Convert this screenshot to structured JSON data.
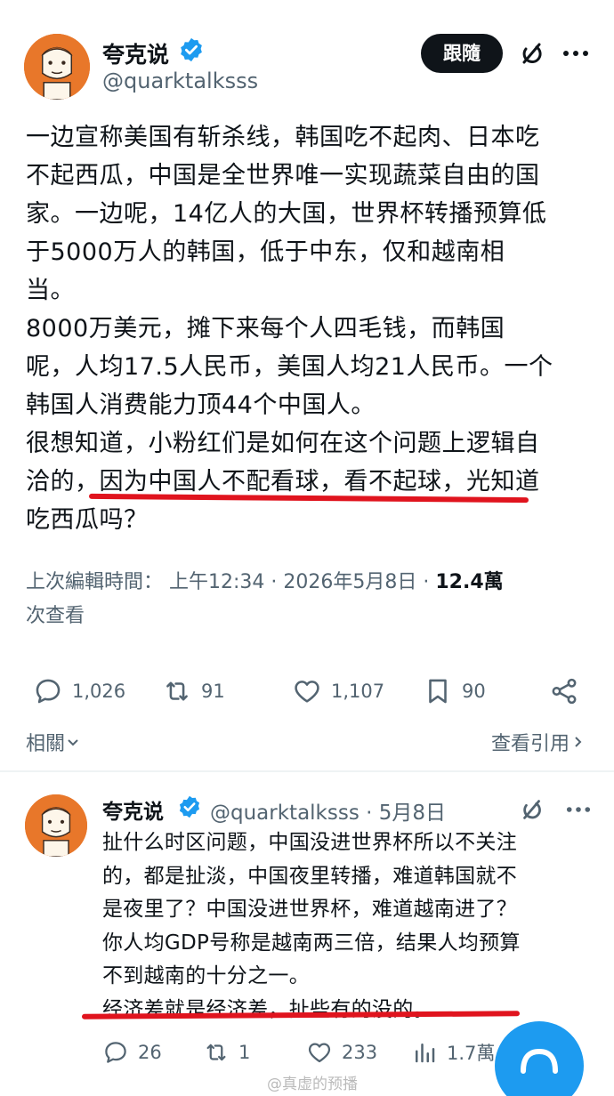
{
  "post": {
    "author_name": "夸克说",
    "author_handle": "@quarktalksss",
    "follow_label": "跟隨",
    "body_lines": [
      "一边宣称美国有斩杀线，韩国吃不起肉、日本吃",
      "不起西瓜，中国是全世界唯一实现蔬菜自由的国",
      "家。一边呢，14亿人的大国，世界杯转播预算低",
      "于5000万人的韩国，低于中东，仅和越南相",
      "当。",
      "8000万美元，摊下来每个人四毛钱，而韩国",
      "呢，人均17.5人民币，美国人均21人民币。一个",
      "韩国人消费能力顶44个中国人。",
      "很想知道，小粉红们是如何在这个问题上逻辑自",
      "洽的，因为中国人不配看球，看不起球，光知道",
      "吃西瓜吗？"
    ],
    "timestamp_prefix": "上次編輯時間： 上午12:34 · 2026年5月8日 · ",
    "views": "12.4萬",
    "views_suffix": "次查看",
    "stats": {
      "replies": "1,026",
      "retweets": "91",
      "likes": "1,107",
      "bookmarks": "90"
    },
    "related_label": "相關",
    "quotes_label": "查看引用"
  },
  "reply": {
    "author_name": "夸克说",
    "meta": "@quarktalksss · 5月8日",
    "body_lines": [
      "扯什么时区问题，中国没进世界杯所以不关注",
      "的，都是扯淡，中国夜里转播，难道韩国就不",
      "是夜里了？中国没进世界杯，难道越南进了？",
      "你人均GDP号称是越南两三倍，结果人均预算",
      "不到越南的十分之一。",
      "经济差就是经济差，扯些有的没的。"
    ],
    "stats": {
      "replies": "26",
      "retweets": "1",
      "likes": "233",
      "views": "1.7萬"
    }
  },
  "watermark": "@真虚的预播",
  "colors": {
    "accent": "#1d9bf0",
    "underline": "#e0141e",
    "avatar_bg": "#e8772a",
    "secondary_text": "#536471"
  }
}
